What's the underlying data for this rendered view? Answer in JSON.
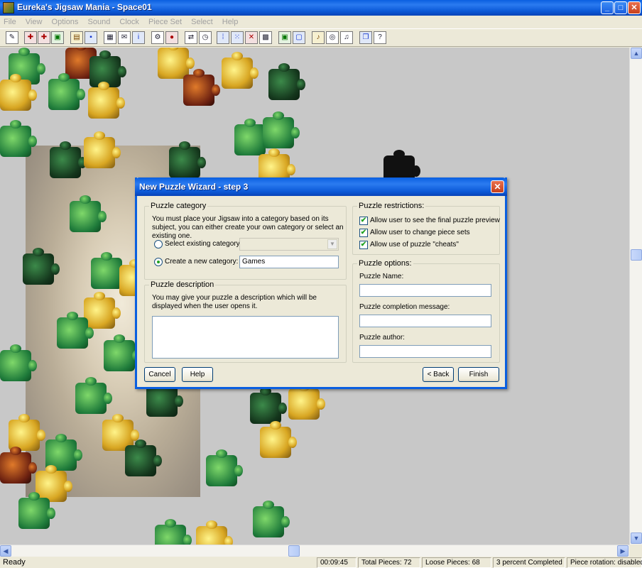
{
  "window": {
    "title": "Eureka's Jigsaw Mania - Space01",
    "min": "_",
    "max": "□",
    "close": "✕"
  },
  "menu": [
    "File",
    "View",
    "Options",
    "Sound",
    "Clock",
    "Piece Set",
    "Select",
    "Help"
  ],
  "toolbar_icons": [
    "wand-icon",
    "puzzle-red-icon",
    "puzzle-red2-icon",
    "picture-icon",
    "open-icon",
    "save-icon",
    "print-icon",
    "mail-icon",
    "info-icon",
    "settings-icon",
    "colors-icon",
    "building-icon",
    "shuffle-icon",
    "clock-icon",
    "grid-icon",
    "grid-select-icon",
    "remove-icon",
    "qr-icon",
    "edges-icon",
    "frame-icon",
    "sound-icon",
    "cd-icon",
    "music-icon",
    "copy-icon",
    "help-icon"
  ],
  "dialog": {
    "title": "New Puzzle Wizard - step 3",
    "category": {
      "legend": "Puzzle category",
      "text": "You must place your Jigsaw into a category based on its subject, you can either create your own category or select an existing one.",
      "select_existing_label": "Select existing category:",
      "select_existing_value": "",
      "create_new_label": "Create a new category:",
      "create_new_value": "Games"
    },
    "description": {
      "legend": "Puzzle description",
      "text": "You may give your puzzle a description which will be displayed when the user opens it.",
      "value": ""
    },
    "restrictions": {
      "legend": "Puzzle restrictions:",
      "items": [
        {
          "label": "Allow user to see the final puzzle preview",
          "checked": true
        },
        {
          "label": "Allow user to change piece sets",
          "checked": true
        },
        {
          "label": "Allow use of puzzle \"cheats\"",
          "checked": true
        }
      ]
    },
    "options": {
      "legend": "Puzzle options:",
      "name_label": "Puzzle Name:",
      "name_value": "",
      "message_label": "Puzzle completion message:",
      "message_value": "",
      "author_label": "Puzzle author:",
      "author_value": ""
    },
    "buttons": {
      "cancel": "Cancel",
      "help": "Help",
      "back": "< Back",
      "finish": "Finish"
    }
  },
  "status": {
    "ready": "Ready",
    "time": "00:09:45",
    "total": "Total Pieces: 72",
    "loose": "Loose Pieces: 68",
    "completed": "3 percent Completed",
    "rotation": "Piece rotation: disabled"
  },
  "scroll": {
    "up": "▲",
    "down": "▼",
    "left": "◀",
    "right": "▶"
  },
  "checkmark": "✔",
  "colors": {
    "xp_blue": "#0a5fe0",
    "canvas": "#c8c8c8",
    "dialog_bg": "#ece9d8"
  }
}
